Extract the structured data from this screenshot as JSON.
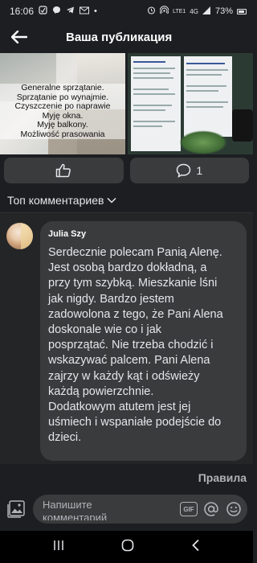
{
  "status_bar": {
    "time": "16:06",
    "network": "LTE1",
    "signal_label": "4G",
    "battery": "73%"
  },
  "header": {
    "title": "Ваша публикация"
  },
  "post_image": {
    "promo_lines": [
      "Generalne sprzątanie.",
      "Sprzątanie po wynajmie.",
      "Czyszczenie po naprawie",
      "Myję okna.",
      "Myję balkony.",
      "Możliwość prasowania"
    ]
  },
  "actions": {
    "comment_count": "1"
  },
  "comments_section": {
    "sort_label": "Топ комментариев"
  },
  "comment": {
    "author": "Julia Szy",
    "lines": [
      "Serdecznie polecam Panią Alenę.",
      "Jest osobą bardzo dokładną, a",
      "przy tym szybką. Mieszkanie lśni",
      "jak nigdy. Bardzo jestem",
      "zadowolona z tego, że Pani Alena",
      "doskonale wie co i jak",
      "posprzątać. Nie trzeba chodzić i",
      "wskazywać palcem. Pani Alena",
      "zajrzy w każdy kąt i odświeży",
      "każdą powierzchnie.",
      "Dodatkowym atutem jest jej",
      "uśmiech i wspaniałe podejście do",
      "dzieci."
    ]
  },
  "rules": {
    "label": "Правила"
  },
  "compose": {
    "placeholder_line1": "Напишите",
    "placeholder_line2": "комментарий",
    "gif_label": "GIF"
  },
  "colors": {
    "background": "#1c1e21",
    "surface": "#3a3b3c",
    "text": "#e4e6eb",
    "muted": "#b0b3b8"
  }
}
